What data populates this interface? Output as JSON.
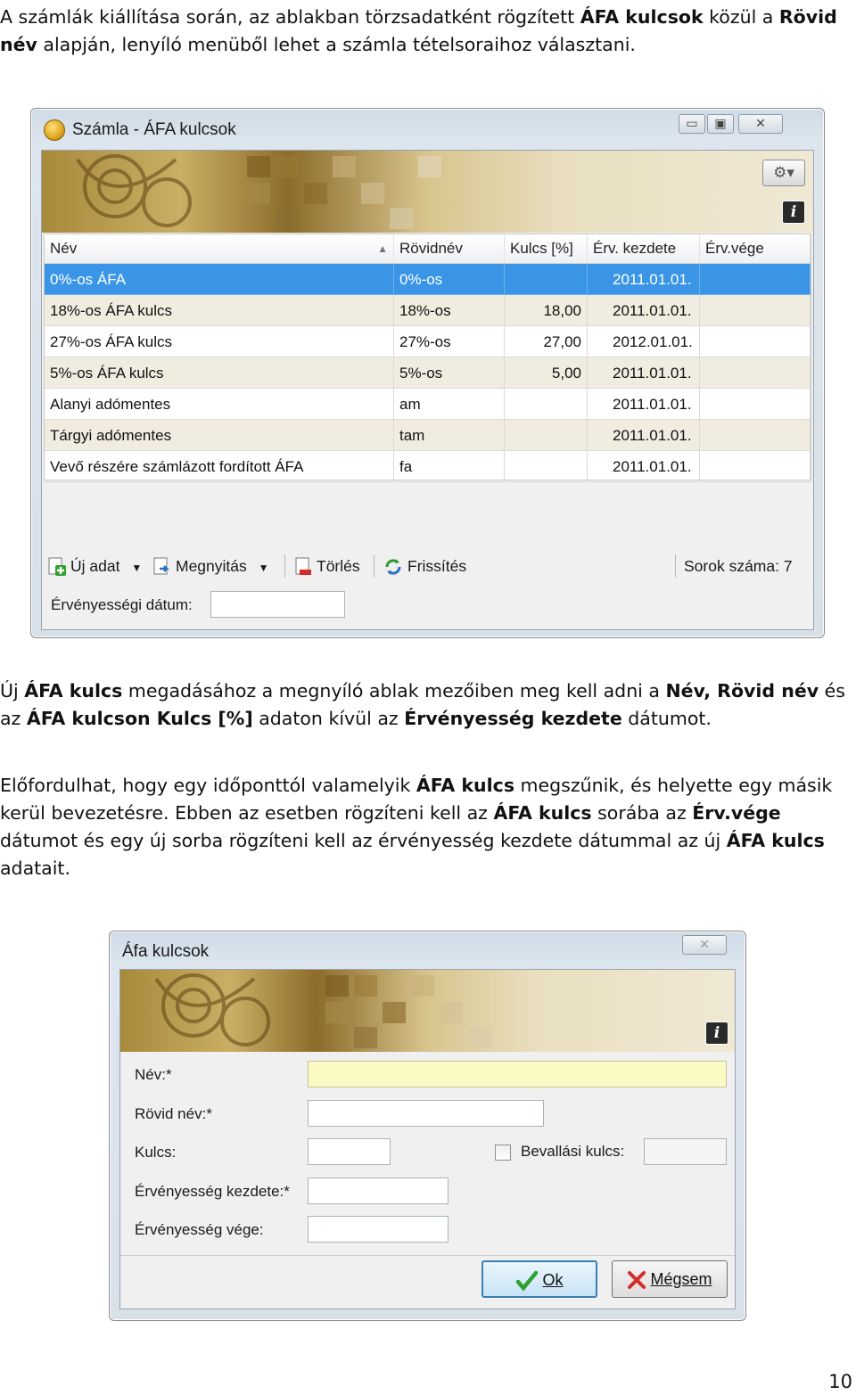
{
  "text": {
    "intro": "A számlák kiállítása során, az ablakban törzsadatként rögzített <b>ÁFA kulcsok</b> közül a <b>Rövid név</b> alapján, lenyíló menüből lehet a számla tételsoraihoz választani.",
    "para2": "Új <b>ÁFA kulcs</b> megadásához a megnyíló ablak mezőiben meg kell adni a <b>Név, Rövid név</b> és az <b>ÁFA kulcson Kulcs [%]</b> adaton kívül az <b>Érvényesség kezdete</b> dátumot.",
    "para3": "Előfordulhat, hogy egy időponttól valamelyik <b>ÁFA kulcs</b> megszűnik, és helyette egy másik kerül bevezetésre. Ebben az esetben rögzíteni kell az <b>ÁFA kulcs</b> sorába az <b>Érv.vége</b> dátumot és egy új sorba rögzíteni kell az érvényesség kezdete dátummal az új <b>ÁFA kulcs</b> adatait.",
    "page_number": "10"
  },
  "window1": {
    "title": "Számla - ÁFA kulcsok",
    "columns": [
      "Név",
      "Rövidnév",
      "Kulcs [%]",
      "Érv. kezdete",
      "Érv.vége"
    ],
    "rows": [
      [
        "0%-os ÁFA",
        "0%-os",
        "",
        "2011.01.01.",
        ""
      ],
      [
        "18%-os ÁFA kulcs",
        "18%-os",
        "18,00",
        "2011.01.01.",
        ""
      ],
      [
        "27%-os ÁFA kulcs",
        "27%-os",
        "27,00",
        "2012.01.01.",
        ""
      ],
      [
        "5%-os ÁFA kulcs",
        "5%-os",
        "5,00",
        "2011.01.01.",
        ""
      ],
      [
        "Alanyi adómentes",
        "am",
        "",
        "2011.01.01.",
        ""
      ],
      [
        "Tárgyi adómentes",
        "tam",
        "",
        "2011.01.01.",
        ""
      ],
      [
        "Vevő részére számlázott fordított ÁFA",
        "fa",
        "",
        "2011.01.01.",
        ""
      ]
    ],
    "toolbar": {
      "new": "Új adat",
      "open": "Megnyitás",
      "delete": "Törlés",
      "refresh": "Frissítés",
      "row_count": "Sorok száma: 7"
    },
    "validity_label": "Érvényességi dátum:",
    "validity_value": ""
  },
  "window2": {
    "title": "Áfa kulcsok",
    "labels": {
      "name": "Név:*",
      "short_name": "Rövid név:*",
      "rate": "Kulcs:",
      "tax_return_rate": "Bevallási kulcs:",
      "valid_from": "Érvényesség kezdete:*",
      "valid_to": "Érvényesség vége:"
    },
    "values": {
      "name": "",
      "short_name": "",
      "rate": "",
      "tax_return_rate": "",
      "valid_from": "",
      "valid_to": ""
    },
    "ok_label": "Ok",
    "cancel_label": "Mégsem"
  },
  "colors": {
    "selection": "#3a95e6",
    "alt_row": "#f1ece0",
    "required_field": "#fbfac4"
  }
}
